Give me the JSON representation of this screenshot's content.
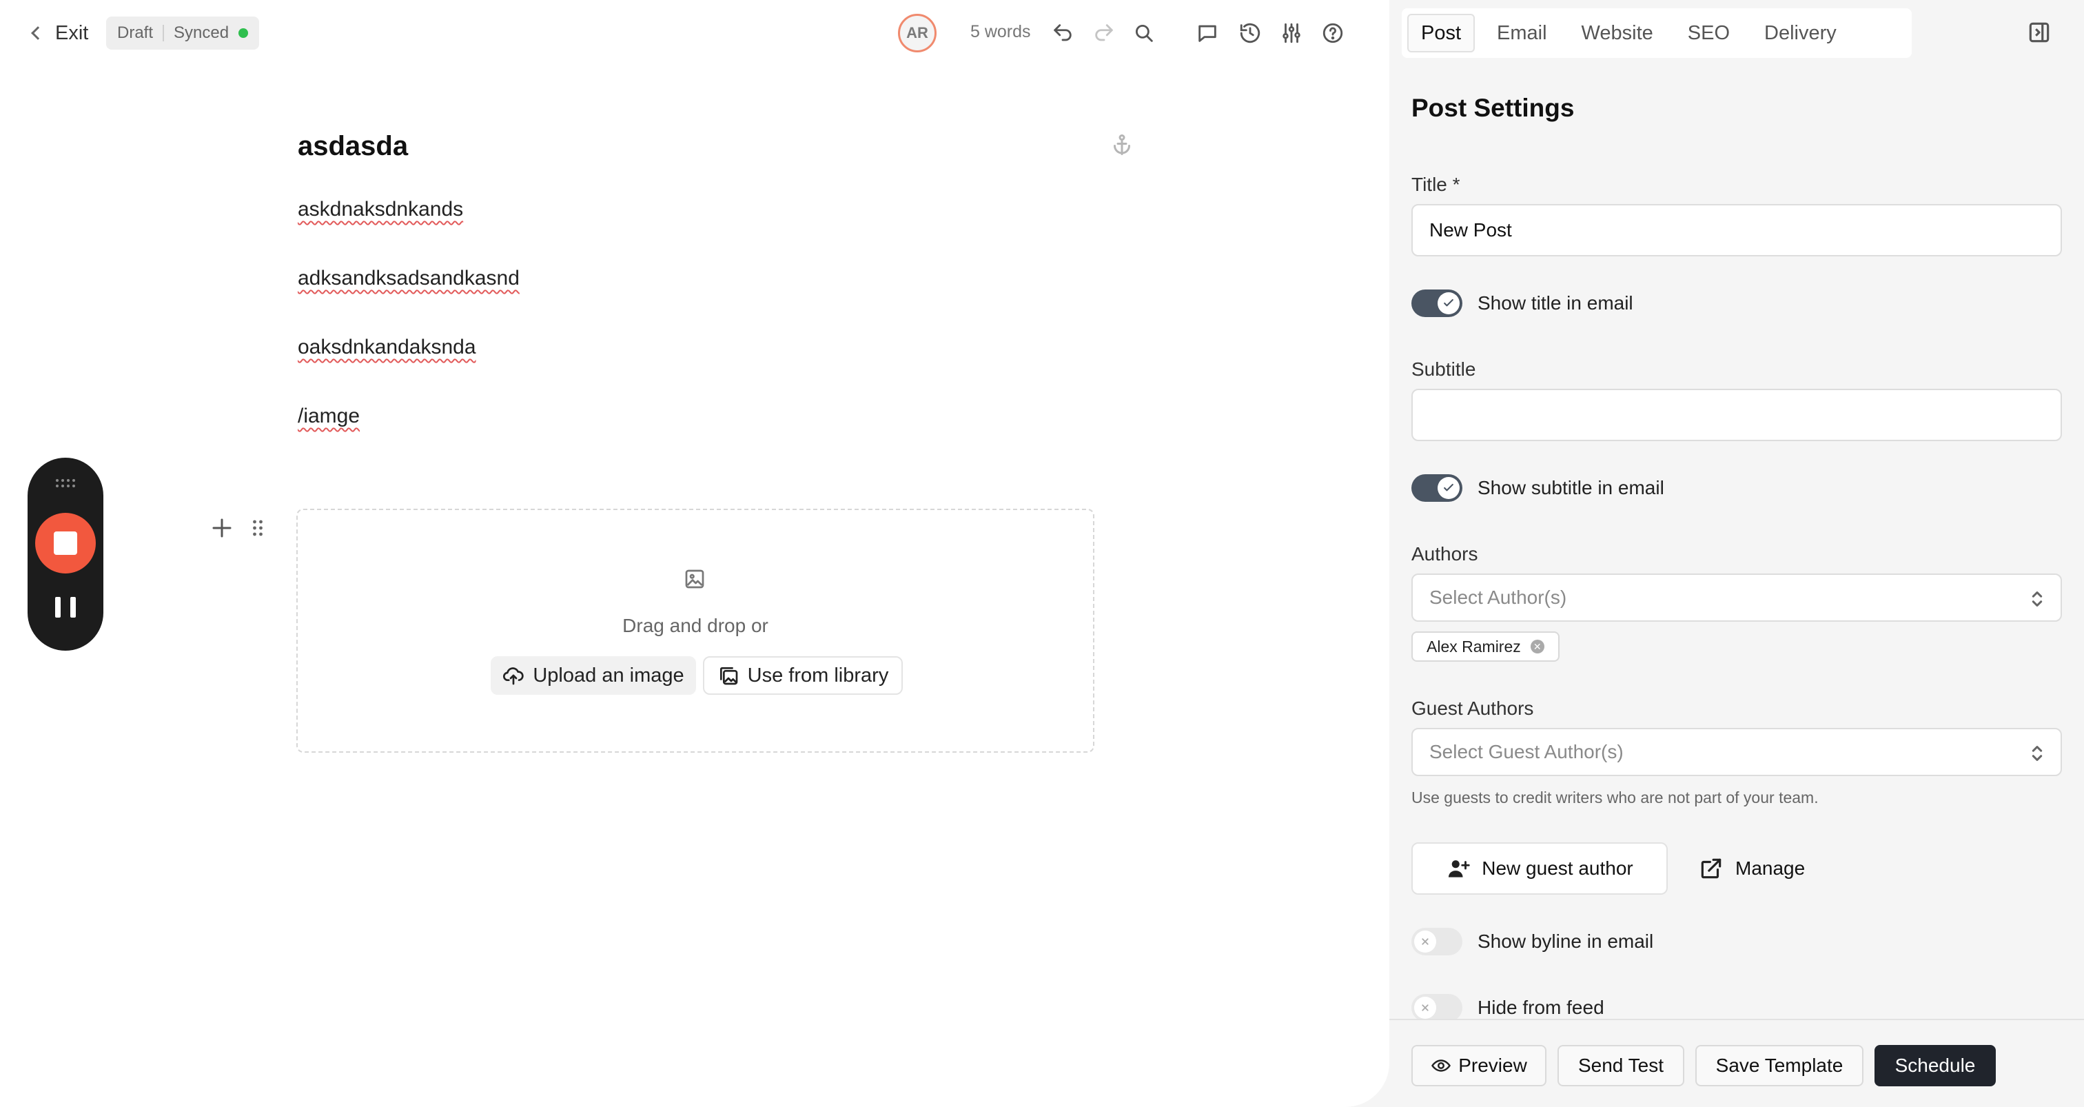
{
  "topbar": {
    "exit_label": "Exit",
    "status": "Draft",
    "sync_status": "Synced",
    "avatar_initials": "AR",
    "word_count": "5 words"
  },
  "document": {
    "title": "asdasda",
    "paragraphs": [
      "askdnaksdnkands",
      "adksandksadsandkasnd",
      "oaksdnkandaksnda",
      "/iamge"
    ]
  },
  "image_block": {
    "drag_text": "Drag and drop or",
    "upload_label": "Upload an image",
    "library_label": "Use from library"
  },
  "sidebar": {
    "tabs": [
      "Post",
      "Email",
      "Website",
      "SEO",
      "Delivery"
    ],
    "active_tab": "Post",
    "heading": "Post Settings",
    "title_label": "Title *",
    "title_value": "New Post",
    "show_title_label": "Show title in email",
    "subtitle_label": "Subtitle",
    "subtitle_value": "",
    "show_subtitle_label": "Show subtitle in email",
    "authors_label": "Authors",
    "authors_placeholder": "Select Author(s)",
    "selected_author": "Alex Ramirez",
    "guest_authors_label": "Guest Authors",
    "guest_authors_placeholder": "Select Guest Author(s)",
    "guest_hint": "Use guests to credit writers who are not part of your team.",
    "new_guest_label": "New guest author",
    "manage_label": "Manage",
    "show_byline_label": "Show byline in email",
    "hide_feed_label": "Hide from feed",
    "toggles": {
      "show_title": true,
      "show_subtitle": true,
      "show_byline": false,
      "hide_from_feed": false
    }
  },
  "footer": {
    "preview_label": "Preview",
    "send_test_label": "Send Test",
    "save_template_label": "Save Template",
    "schedule_label": "Schedule"
  },
  "colors": {
    "accent_record": "#f2583e",
    "toggle_on": "#4a5563",
    "synced_dot": "#2fbf4e",
    "primary_button": "#20242c"
  }
}
